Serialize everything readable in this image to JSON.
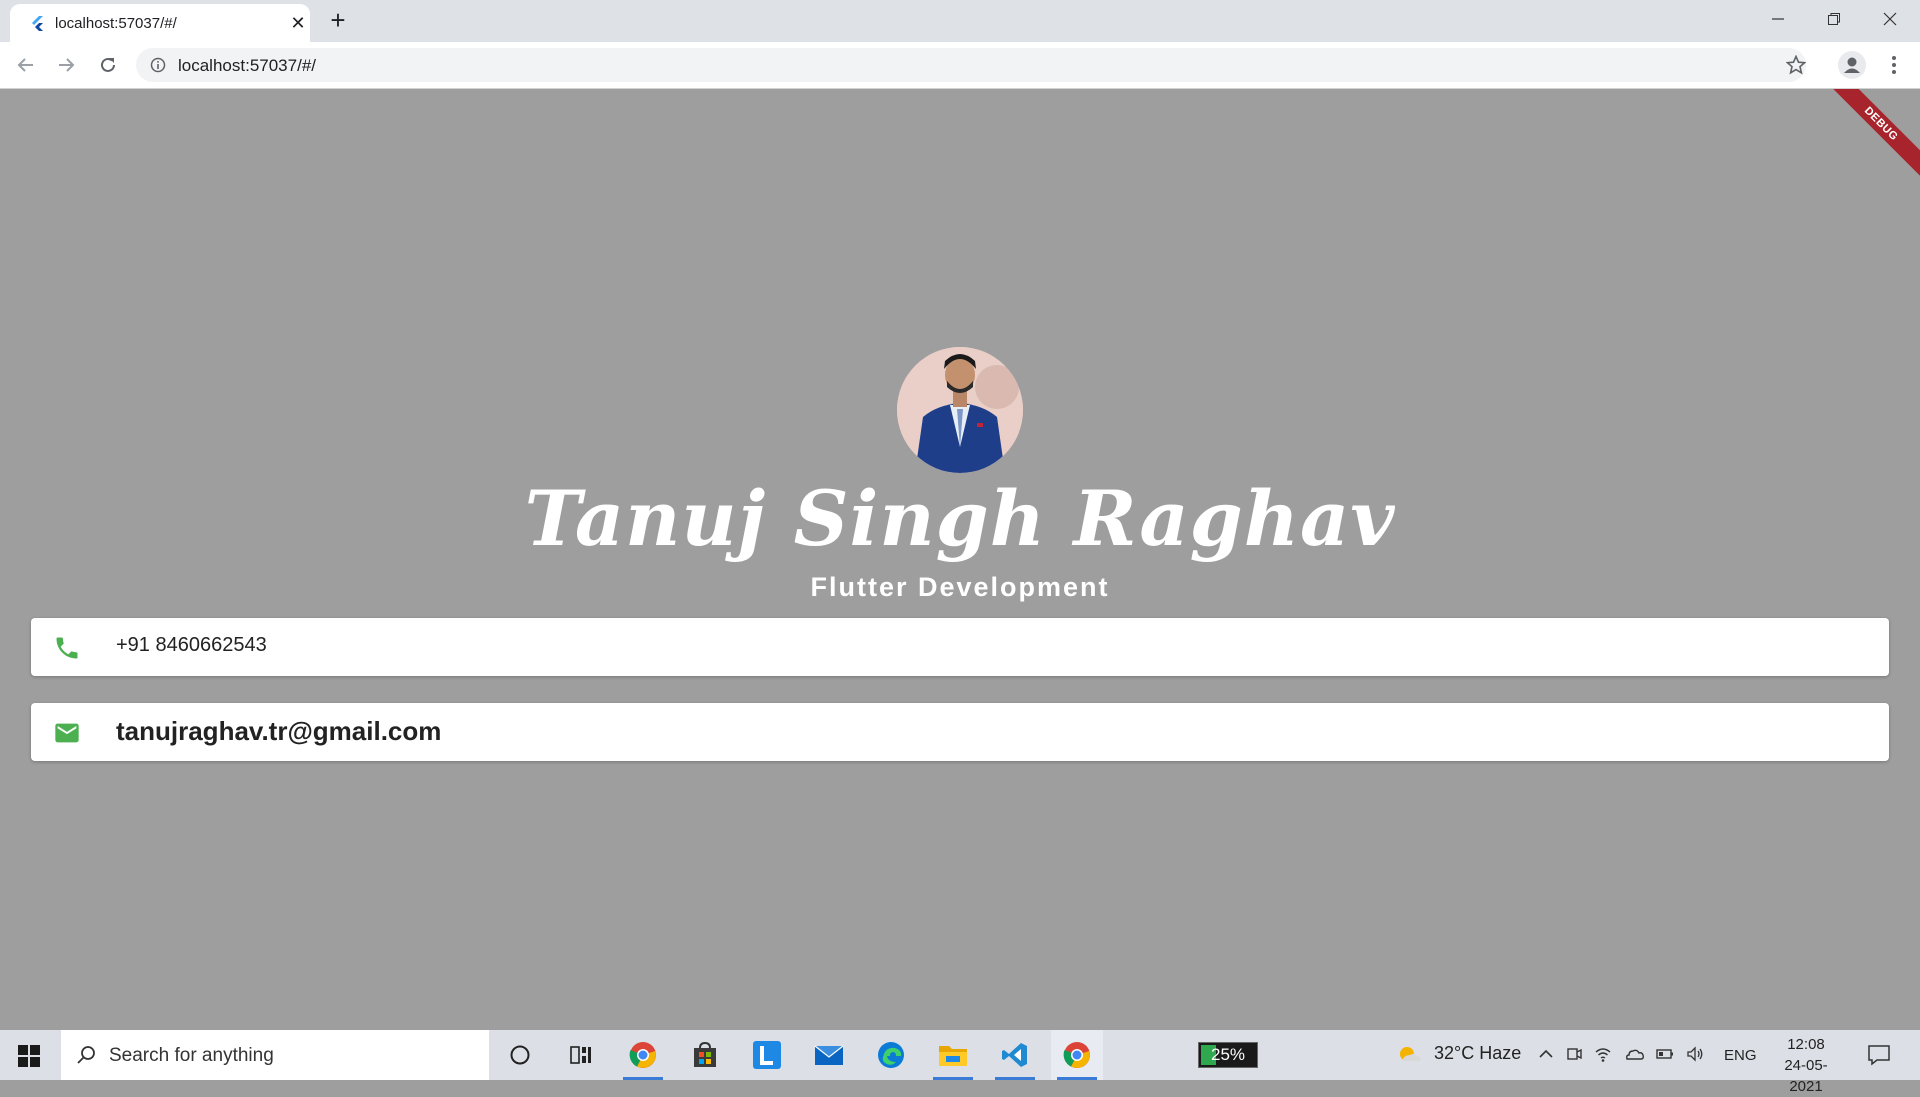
{
  "browser": {
    "tab_title": "localhost:57037/#/",
    "url": "localhost:57037/#/"
  },
  "app": {
    "debug_label": "DEBUG",
    "name": "Tanuj Singh Raghav",
    "subtitle": "Flutter Development",
    "phone": "+91 8460662543",
    "email": "tanujraghav.tr@gmail.com",
    "background_color": "#9e9e9e",
    "icon_color": "#4caf50"
  },
  "taskbar": {
    "search_placeholder": "Search for anything",
    "battery": "25%",
    "weather": "32°C  Haze",
    "language": "ENG",
    "time": "12:08",
    "date": "24-05-2021"
  }
}
